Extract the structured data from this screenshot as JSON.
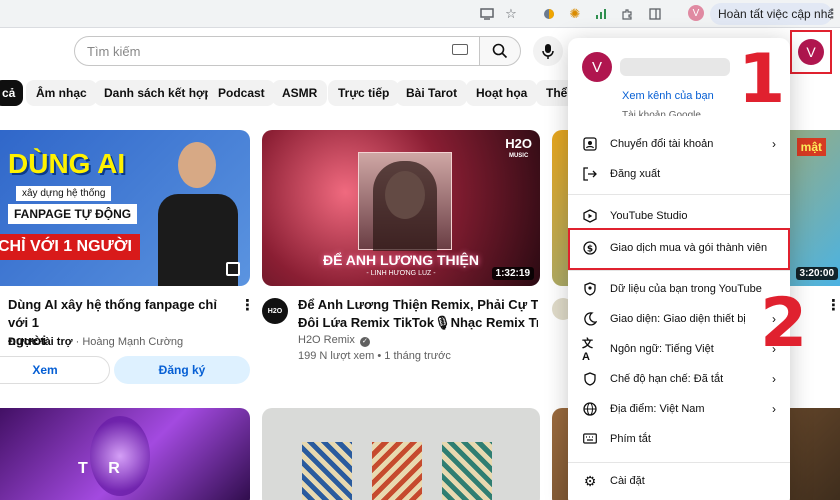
{
  "browser": {
    "ext_button_label": "Hoàn tất việc cập nhật",
    "profile_initial": "V"
  },
  "header": {
    "search_placeholder": "Tìm kiếm",
    "avatar_initial": "V"
  },
  "chips": [
    "cả",
    "Âm nhạc",
    "Danh sách kết hợp",
    "Podcast",
    "ASMR",
    "Trực tiếp",
    "Bài Tarot",
    "Hoạt họa",
    "Thể c"
  ],
  "videos": [
    {
      "thumb_title_1": "DÙNG AI",
      "thumb_title_2": "xây dựng hệ thống",
      "thumb_title_3": "FANPAGE TỰ ĐỘNG",
      "thumb_title_4": "CHỈ VỚI 1 NGƯỜI",
      "title_line1": "Dùng AI xây hệ thống fanpage chỉ với 1",
      "title_line2": "người",
      "sponsored": "Được tài trợ",
      "channel": "Hoàng Mạnh Cường",
      "btn_view": "Xem",
      "btn_subscribe": "Đăng ký"
    },
    {
      "thumb_logo": "H2O",
      "thumb_sub": "MUSIC",
      "thumb_title": "ĐỂ ANH LƯƠNG THIỆN",
      "thumb_artist": "- LINH HƯƠNG LUZ -",
      "duration": "1:32:19",
      "channel_avatar": "H2O",
      "title_line1": "Để Anh Lương Thiện Remix, Phải Cự Tuyệt",
      "title_line2": "Đôi Lứa Remix TikTok🎙Nhạc Remix Triệ...",
      "channel": "H2O Remix",
      "views": "199 N lượt xem",
      "age": "1 tháng trước"
    },
    {
      "duration": "3:20:00",
      "thumb_text": "mật"
    }
  ],
  "menu": {
    "avatar_initial": "V",
    "channel_link": "Xem kênh của bạn",
    "cut_item": "Tài khoản Google",
    "items": [
      {
        "label": "Chuyển đổi tài khoản",
        "arrow": "›"
      },
      {
        "label": "Đăng xuất"
      },
      {
        "label": "YouTube Studio"
      },
      {
        "label": "Giao dịch mua và gói thành viên"
      },
      {
        "label": "Dữ liệu của bạn trong YouTube"
      },
      {
        "label": "Giao diện: Giao diện thiết bị",
        "arrow": "›"
      },
      {
        "label": "Ngôn ngữ: Tiếng Việt",
        "arrow": "›"
      },
      {
        "label": "Chế độ hạn chế: Đã tắt",
        "arrow": "›"
      },
      {
        "label": "Địa điểm: Việt Nam",
        "arrow": "›"
      },
      {
        "label": "Phím tắt"
      },
      {
        "label": "Cài đặt"
      }
    ]
  },
  "annotations": {
    "step1": "1",
    "step2": "2"
  }
}
